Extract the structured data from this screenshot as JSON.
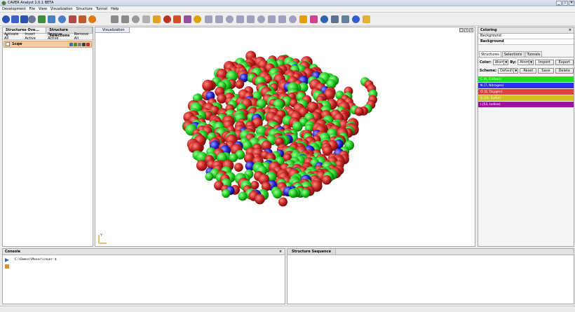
{
  "window": {
    "title": "CAVER Analyst 1.0.1 BETA"
  },
  "menu": [
    "Development",
    "File",
    "View",
    "Visualization",
    "Structure",
    "Tunnel",
    "Help"
  ],
  "toolbar_icons": [
    {
      "name": "blue-arrow",
      "color": "#2c52b8"
    },
    {
      "name": "blue-arrow-2",
      "color": "#3a62c8"
    },
    {
      "name": "blue-arrow-3",
      "color": "#2c52b8"
    },
    {
      "name": "gears",
      "color": "#6a7a94"
    },
    {
      "name": "gears-green",
      "color": "#3b8f3b"
    },
    {
      "name": "layers",
      "color": "#4a7fc8"
    },
    {
      "name": "layers-2",
      "color": "#4a7fc8"
    },
    {
      "name": "multi",
      "color": "#b24848"
    },
    {
      "name": "multi-2",
      "color": "#c05a2a"
    },
    {
      "name": "ring-orange",
      "color": "#e07a10"
    },
    {
      "name": "hands",
      "color": "#8a8a8a"
    },
    {
      "name": "hands-2",
      "color": "#8a8a8a"
    },
    {
      "name": "chain",
      "color": "#9a9a9a"
    },
    {
      "name": "tube",
      "color": "#b0b0b0"
    },
    {
      "name": "pencil",
      "color": "#e6a020"
    },
    {
      "name": "pen-red",
      "color": "#c03020"
    },
    {
      "name": "ring-red",
      "color": "#d05020"
    },
    {
      "name": "curl",
      "color": "#9050a0"
    },
    {
      "name": "wand",
      "color": "#e0a000"
    },
    {
      "name": "fork",
      "color": "#a0a0c0"
    },
    {
      "name": "fork-2",
      "color": "#a0a0c0"
    },
    {
      "name": "fork-3",
      "color": "#a0a0c0"
    },
    {
      "name": "fork-4",
      "color": "#a0a0c0"
    },
    {
      "name": "fork-5",
      "color": "#a0a0c0"
    },
    {
      "name": "fork-6",
      "color": "#a0a0c0"
    },
    {
      "name": "fork-7",
      "color": "#a0a0c0"
    },
    {
      "name": "fork-8",
      "color": "#a0a0c0"
    },
    {
      "name": "fork-9",
      "color": "#a0a0c0"
    },
    {
      "name": "wand-2",
      "color": "#e0a000"
    },
    {
      "name": "color-wheel",
      "color": "#d04090"
    },
    {
      "name": "camera",
      "color": "#3060b0"
    },
    {
      "name": "gears-3",
      "color": "#607090"
    },
    {
      "name": "wrench",
      "color": "#6080a0"
    },
    {
      "name": "square-blue",
      "color": "#3060d0"
    },
    {
      "name": "tiles",
      "color": "#e0b030"
    }
  ],
  "left_panel": {
    "tabs": [
      "Structures Ove...",
      "Structure Selections"
    ],
    "close_glyph": "×",
    "actions": [
      "Activate All",
      "Invert Active",
      "Remove Active",
      "Remove All"
    ],
    "structure": {
      "name": "1cqw"
    }
  },
  "viz": {
    "tab": "Visualization",
    "axis_label": "Y"
  },
  "coloring": {
    "title": "Coloring",
    "close_glyph": "×",
    "bg_label": "Background",
    "bg_value": "Background",
    "tabs": [
      "Structures",
      "Selections",
      "Tunnels"
    ],
    "color_label": "Color:",
    "color_value": "Atoms",
    "by_label": "By:",
    "by_value": "Atom...",
    "import_label": "Import",
    "export_label": "Export",
    "scheme_label": "Scheme:",
    "scheme_value": "Default",
    "reset_label": "Reset",
    "save_label": "Save",
    "delete_label": "Delete",
    "elements": [
      {
        "label": "C (6, Carbon)",
        "color": "#22dd22"
      },
      {
        "label": "N (7, Nitrogen)",
        "color": "#3030e0"
      },
      {
        "label": "O (8, Oxygen)",
        "color": "#e04040"
      },
      {
        "label": "S (16, Sulfur)",
        "color": "#d0c020"
      },
      {
        "label": "I (53, Iodine)",
        "color": "#a010a0"
      }
    ]
  },
  "console": {
    "title": "Console",
    "close_glyph": "×",
    "prompt": "C:\\Demos\\Mesoc\\caver-$"
  },
  "sequence": {
    "title": "Structure Sequence"
  }
}
